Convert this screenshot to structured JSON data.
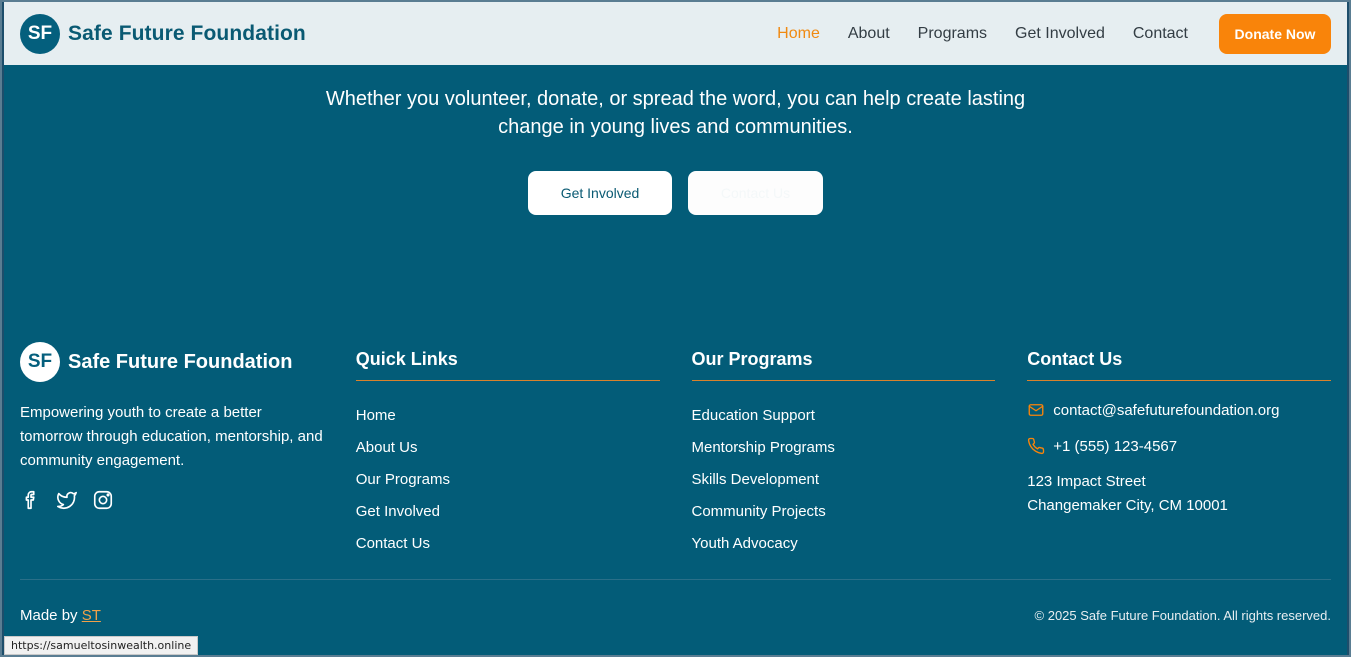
{
  "header": {
    "logo_initials": "SF",
    "brand": "Safe Future Foundation",
    "nav": [
      "Home",
      "About",
      "Programs",
      "Get Involved",
      "Contact"
    ],
    "active_nav": "Home",
    "donate_label": "Donate Now"
  },
  "cta": {
    "line1": "Whether you volunteer, donate, or spread the word, you can help create lasting",
    "line2": "change in young lives and communities.",
    "primary_button": "Get Involved",
    "secondary_button": "Contact Us"
  },
  "footer": {
    "logo_initials": "SF",
    "brand": "Safe Future Foundation",
    "description": "Empowering youth to create a better tomorrow through education, mentorship, and community engagement.",
    "socials": [
      "facebook-icon",
      "twitter-icon",
      "instagram-icon"
    ],
    "quick_links": {
      "title": "Quick Links",
      "items": [
        "Home",
        "About Us",
        "Our Programs",
        "Get Involved",
        "Contact Us"
      ]
    },
    "programs": {
      "title": "Our Programs",
      "items": [
        "Education Support",
        "Mentorship Programs",
        "Skills Development",
        "Community Projects",
        "Youth Advocacy"
      ]
    },
    "contact": {
      "title": "Contact Us",
      "email": "contact@safefuturefoundation.org",
      "phone": "+1 (555) 123-4567",
      "address_line1": "123 Impact Street",
      "address_line2": "Changemaker City, CM 10001"
    },
    "made_by_prefix": "Made by",
    "made_by_link": "ST",
    "copyright": "© 2025 Safe Future Foundation. All rights reserved."
  },
  "status_bar": {
    "url": "https://samueltosinwealth.online"
  },
  "colors": {
    "primary": "#035c78",
    "accent": "#f9840a",
    "header_bg": "#e6eef1"
  }
}
